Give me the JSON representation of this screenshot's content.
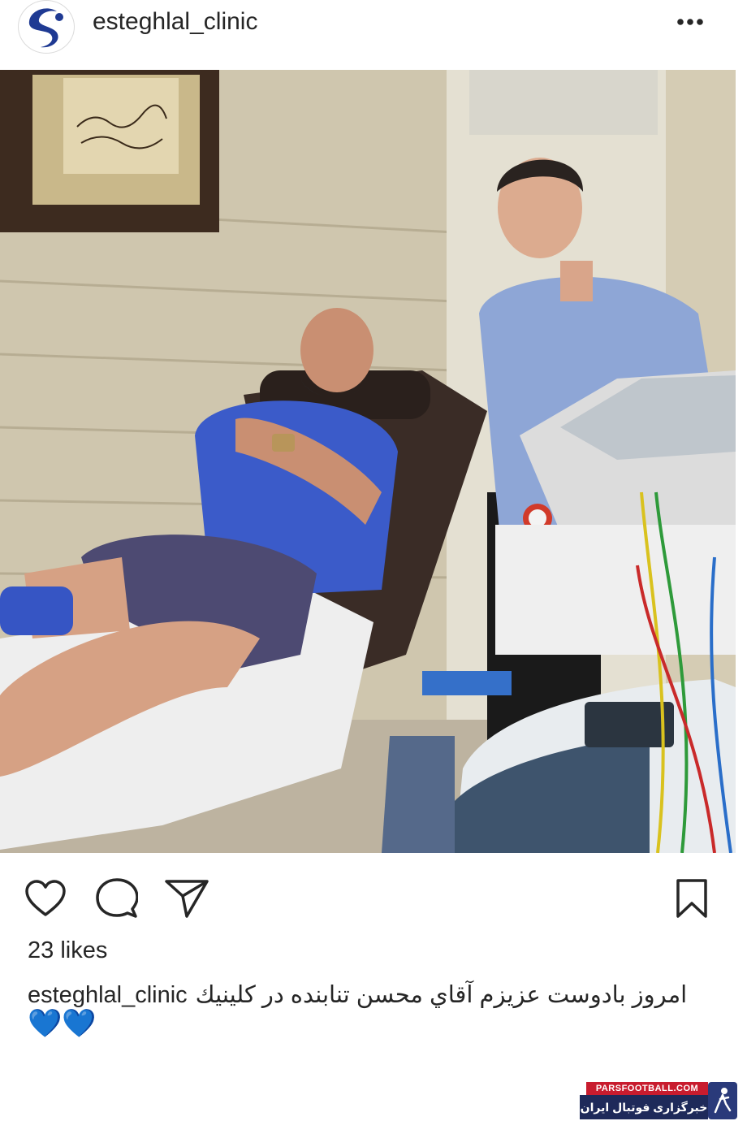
{
  "header": {
    "username": "esteghlal_clinic",
    "more_icon": "more-horizontal-icon"
  },
  "post": {
    "image_alt": "photo-of-patient-and-doctor-in-clinic"
  },
  "actions": {
    "like_icon": "heart-icon",
    "comment_icon": "comment-icon",
    "share_icon": "send-icon",
    "save_icon": "bookmark-icon"
  },
  "likes_text": "23 likes",
  "caption": {
    "username": "esteghlal_clinic",
    "text": "امروز بادوست عزيزم آقاي محسن تنابنده در كلينيك",
    "hearts": "💙💙"
  },
  "watermark": {
    "top": "PARSFOOTBALL.COM",
    "bottom": "خبرگزاری فوتبال ایران"
  },
  "colors": {
    "text": "#262626",
    "watermark_red": "#c81c2e",
    "watermark_blue": "#1e2a5a",
    "clinic_logo_blue": "#1f3a93"
  }
}
